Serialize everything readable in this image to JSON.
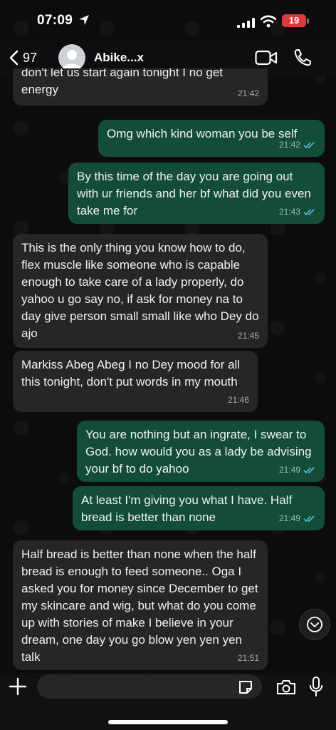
{
  "status_bar": {
    "time": "07:09",
    "battery": "19"
  },
  "header": {
    "back_count": "97",
    "contact_name": "Abike...x"
  },
  "messages": [
    {
      "dir": "in",
      "text": "don't let us start again tonight I no get energy",
      "time": "21:42"
    },
    {
      "dir": "out",
      "text": "Omg which kind woman you be self",
      "time": "21:42"
    },
    {
      "dir": "out",
      "text": "By this time of the day you are going out with ur friends and her bf what did you even take me for",
      "time": "21:43"
    },
    {
      "dir": "in",
      "text": "This is the only thing you know how to do, flex muscle like someone who is capable enough to take care of a lady properly, do yahoo u go say no, if ask for money na to day give person small small like who Dey do ajo",
      "time": "21:45"
    },
    {
      "dir": "in",
      "text": "Markiss Abeg Abeg I no Dey mood for all this tonight, don't put words in my mouth",
      "time": "21:46"
    },
    {
      "dir": "out",
      "text": "You are nothing but an ingrate, I swear to God. how would  you as a lady  be advising your bf to do yahoo",
      "time": "21:49"
    },
    {
      "dir": "out",
      "text": "At least I'm giving you what I have. Half bread is better than none",
      "time": "21:49"
    },
    {
      "dir": "in",
      "text": "Half bread is better than none when the half bread is enough to feed someone.. Oga I asked you for money since December to get my skincare and wig, but what do you come up with stories of make I believe in your dream, one day you go blow yen yen yen talk",
      "time": "21:51"
    }
  ],
  "icons": {
    "location": "location-arrow-icon",
    "signal": "signal-icon",
    "wifi": "wifi-icon",
    "back": "chevron-left-icon",
    "video": "video-call-icon",
    "phone": "phone-icon",
    "read": "double-check-icon",
    "scroll": "chevron-down-icon",
    "plus": "plus-icon",
    "sticker": "sticker-icon",
    "camera": "camera-icon",
    "mic": "microphone-icon"
  },
  "colors": {
    "outgoing_bubble": "#134d37",
    "incoming_bubble": "#262626",
    "read_ticks": "#53bdeb",
    "battery": "#e0383e"
  }
}
